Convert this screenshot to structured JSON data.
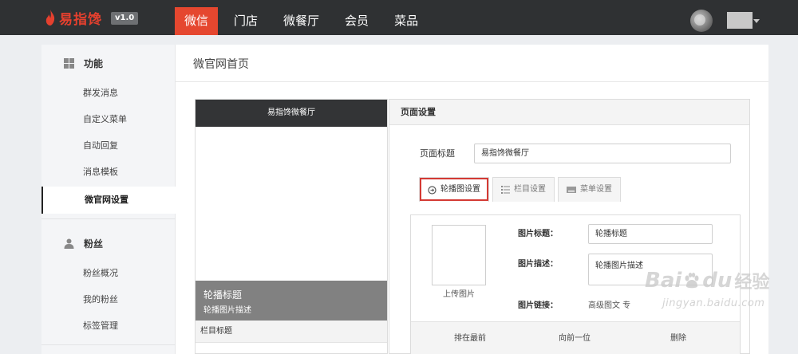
{
  "app": {
    "logo_text": "易指馋",
    "version": "v1.0"
  },
  "nav": {
    "items": [
      {
        "label": "微信",
        "active": true
      },
      {
        "label": "门店",
        "active": false
      },
      {
        "label": "微餐厅",
        "active": false
      },
      {
        "label": "会员",
        "active": false
      },
      {
        "label": "菜品",
        "active": false
      }
    ]
  },
  "sidebar": {
    "groups": [
      {
        "title": "功能",
        "icon": "grid-icon",
        "items": [
          "群发消息",
          "自定义菜单",
          "自动回复",
          "消息模板",
          "微官网设置"
        ]
      },
      {
        "title": "粉丝",
        "icon": "user-icon",
        "items": [
          "粉丝概况",
          "我的粉丝",
          "标签管理"
        ]
      }
    ],
    "active_item": "微官网设置"
  },
  "page": {
    "title": "微官网首页"
  },
  "preview": {
    "header_title": "易指馋微餐厅",
    "banner_title": "轮播标题",
    "banner_desc": "轮播图片描述",
    "column_title": "栏目标题"
  },
  "settings": {
    "header": "页面设置",
    "page_title_label": "页面标题",
    "page_title_value": "易指馋微餐厅",
    "tabs": [
      {
        "label": "轮播图设置",
        "icon": "circle-arrow-icon",
        "active": true
      },
      {
        "label": "栏目设置",
        "icon": "list-icon",
        "active": false
      },
      {
        "label": "菜单设置",
        "icon": "keyboard-icon",
        "active": false
      }
    ],
    "carousel": {
      "upload_label": "上传图片",
      "image_title_label": "图片标题：",
      "image_title_value": "轮播标题",
      "image_desc_label": "图片描述：",
      "image_desc_value": "轮播图片描述",
      "image_link_label": "图片链接：",
      "image_link_value": "高级图文 专",
      "actions": [
        "排在最前",
        "向前一位",
        "删除"
      ]
    }
  },
  "watermark": {
    "text": "Bai",
    "text2": "du",
    "cn": "经验",
    "sub": "jingyan.baidu.com"
  },
  "colors": {
    "topbar": "#2f3133",
    "accent": "#e5472f",
    "highlight": "#d43a34"
  }
}
